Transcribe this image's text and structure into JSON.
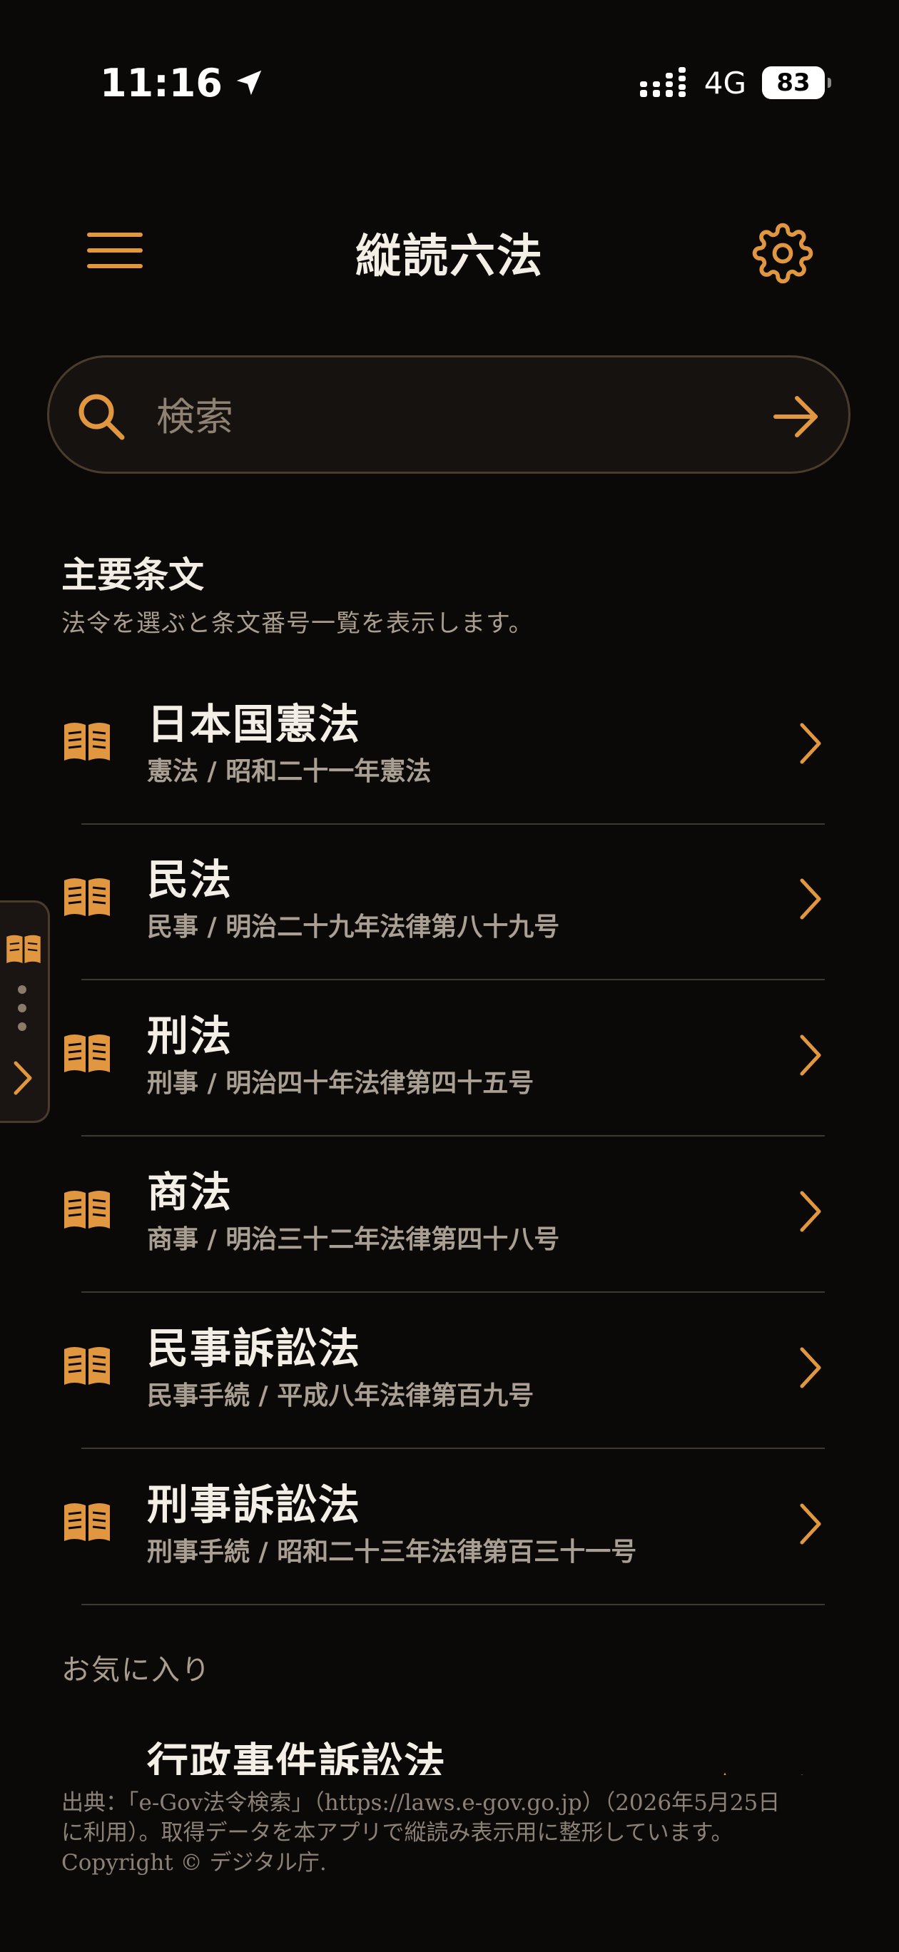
{
  "status_bar": {
    "time": "11:16",
    "network": "4G",
    "battery": "83"
  },
  "header": {
    "title": "縦読六法"
  },
  "search": {
    "placeholder": "検索"
  },
  "main_section": {
    "title": "主要条文",
    "subtitle": "法令を選ぶと条文番号一覧を表示します。",
    "laws": [
      {
        "name": "日本国憲法",
        "meta": "憲法 / 昭和二十一年憲法"
      },
      {
        "name": "民法",
        "meta": "民事 / 明治二十九年法律第八十九号"
      },
      {
        "name": "刑法",
        "meta": "刑事 / 明治四十年法律第四十五号"
      },
      {
        "name": "商法",
        "meta": "商事 / 明治三十二年法律第四十八号"
      },
      {
        "name": "民事訴訟法",
        "meta": "民事手続 / 平成八年法律第百九号"
      },
      {
        "name": "刑事訴訟法",
        "meta": "刑事手続 / 昭和二十三年法律第百三十一号"
      }
    ]
  },
  "favorites": {
    "title": "お気に入り",
    "items": [
      {
        "name": "行政事件訴訟法"
      }
    ]
  },
  "footer": {
    "line1": "出典：「e-Gov法令検索」（https://laws.e-gov.go.jp）（2026年5月25日",
    "line2": "に利用）。取得データを本アプリで縦読み表示用に整形しています。",
    "line3": "Copyright © デジタル庁."
  },
  "colors": {
    "accent": "#e0973f",
    "background": "#0b0908",
    "text": "#f4efe6",
    "muted": "#a99f92"
  }
}
